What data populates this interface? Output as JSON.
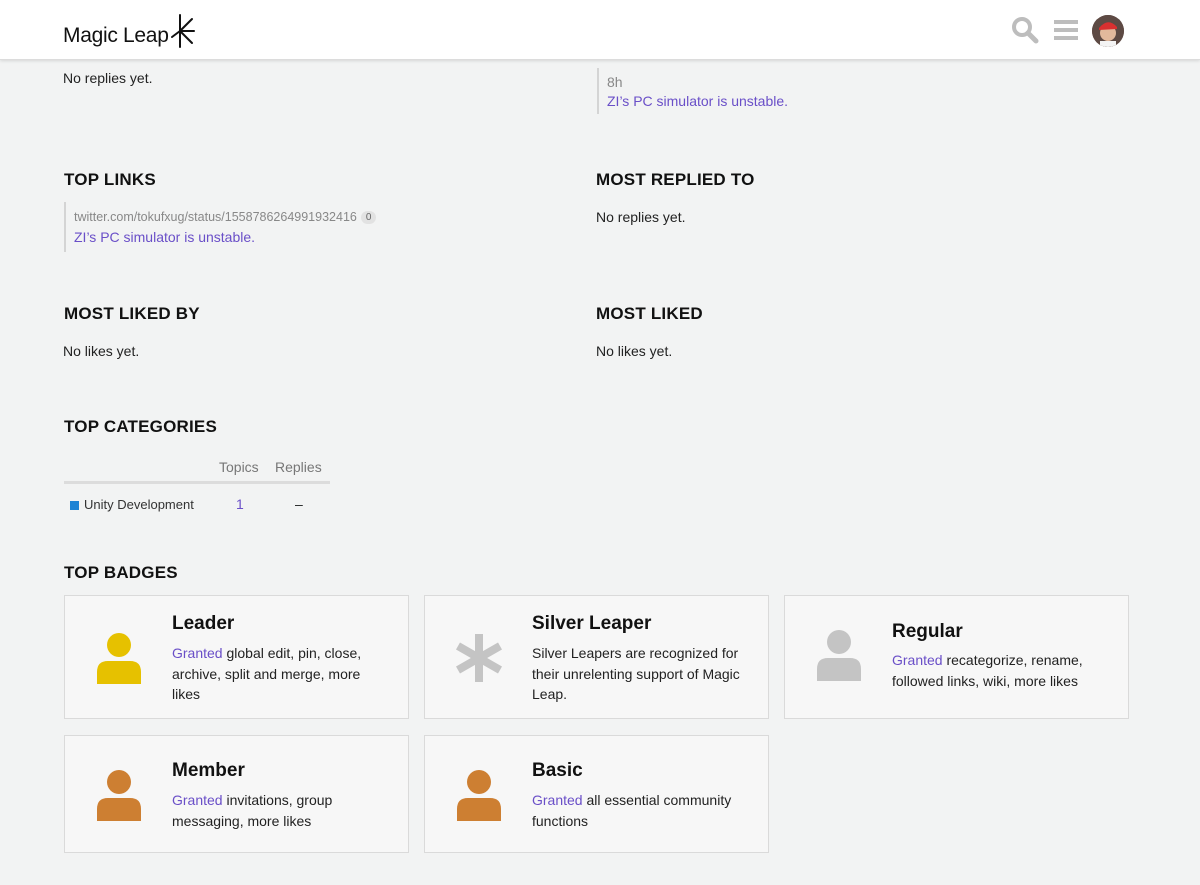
{
  "header": {
    "logo_text": "Magic Leap",
    "icons": [
      "search-icon",
      "hamburger-menu-icon",
      "avatar"
    ]
  },
  "top_replies": {
    "empty_text": "No replies yet."
  },
  "top_topics": {
    "items": [
      {
        "age": "8h",
        "title": "ZI’s PC simulator is unstable."
      }
    ]
  },
  "top_links": {
    "title": "TOP LINKS",
    "items": [
      {
        "url": "twitter.com/tokufxug/status/1558786264991932416",
        "clicks": "0",
        "topic": "ZI’s PC simulator is unstable."
      }
    ]
  },
  "most_replied_to": {
    "title": "MOST REPLIED TO",
    "empty_text": "No replies yet."
  },
  "most_liked_by": {
    "title": "MOST LIKED BY",
    "empty_text": "No likes yet."
  },
  "most_liked": {
    "title": "MOST LIKED",
    "empty_text": "No likes yet."
  },
  "top_categories": {
    "title": "TOP CATEGORIES",
    "columns": [
      "Topics",
      "Replies"
    ],
    "rows": [
      {
        "name": "Unity Development",
        "topics": "1",
        "replies": "–",
        "color": "#1d83d4"
      }
    ]
  },
  "top_badges": {
    "title": "TOP BADGES",
    "badges": [
      {
        "name": "Leader",
        "granted": "Granted",
        "desc": " global edit, pin, close, archive, split and merge, more likes",
        "icon": "user-icon",
        "color": "#e6c100"
      },
      {
        "name": "Silver Leaper",
        "granted": "",
        "desc": "Silver Leapers are recognized for their unrelenting support of Magic Leap.",
        "icon": "asterisk-icon",
        "color": "#c4c4c4"
      },
      {
        "name": "Regular",
        "granted": "Granted",
        "desc": " recategorize, rename, followed links, wiki, more likes",
        "icon": "user-icon",
        "color": "#c4c4c4"
      },
      {
        "name": "Member",
        "granted": "Granted",
        "desc": " invitations, group messaging, more likes",
        "icon": "user-icon",
        "color": "#cd7f32"
      },
      {
        "name": "Basic",
        "granted": "Granted",
        "desc": " all essential community functions",
        "icon": "user-icon",
        "color": "#cd7f32"
      }
    ]
  }
}
